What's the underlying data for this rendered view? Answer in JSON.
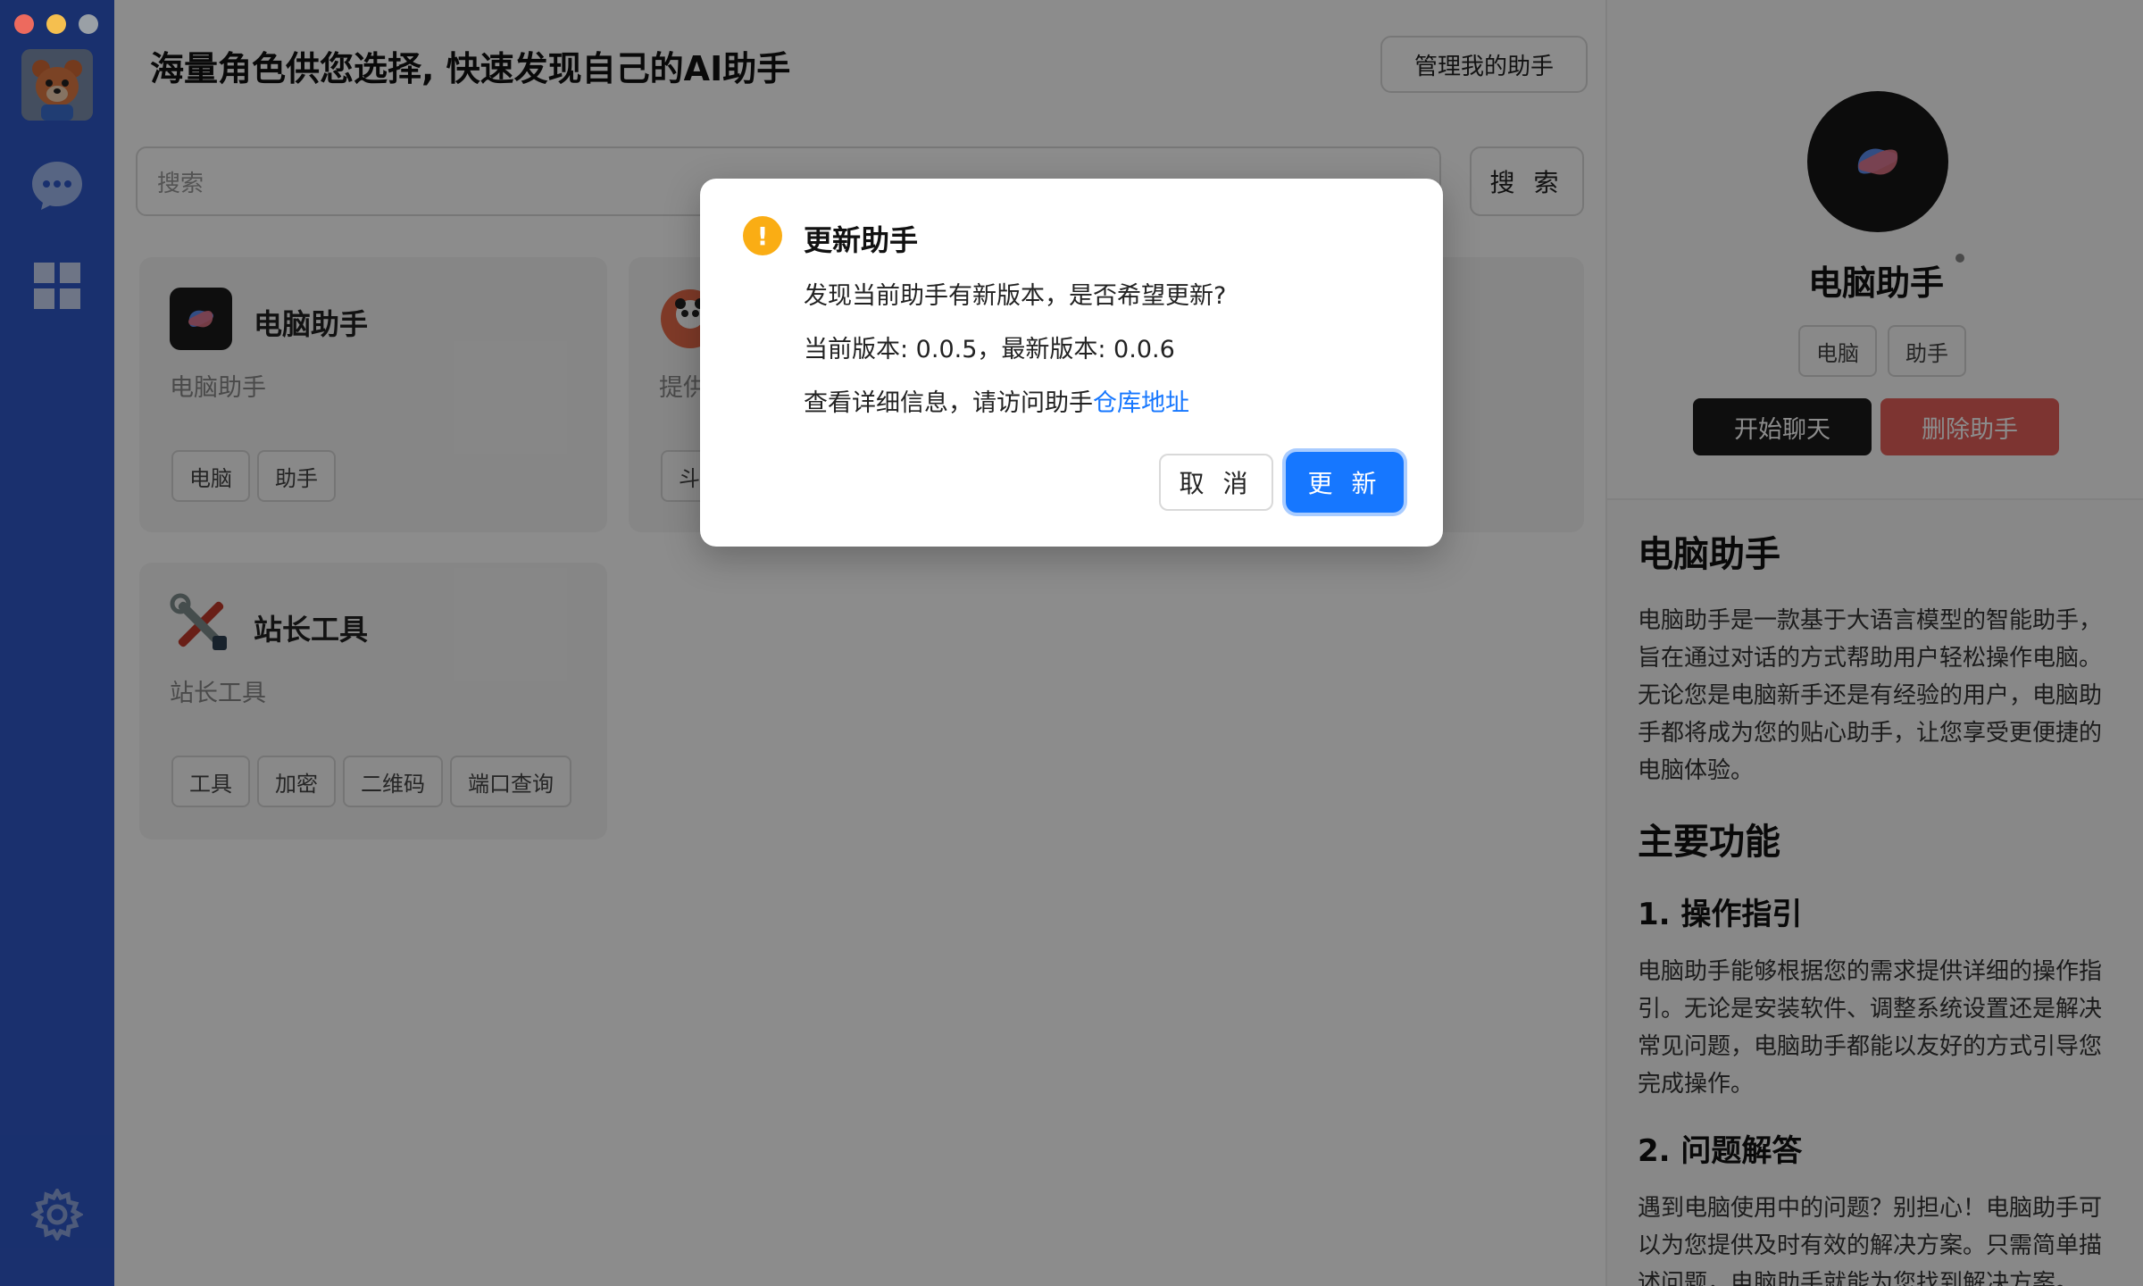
{
  "window": {
    "traffic": [
      "close",
      "minimize",
      "maximize"
    ]
  },
  "sidebar": {
    "items": [
      {
        "icon": "chat-bubble-icon"
      },
      {
        "icon": "grid-icon"
      },
      {
        "icon": "gear-icon"
      }
    ]
  },
  "main": {
    "title": "海量角色供您选择, 快速发现自己的AI助手",
    "manage_label": "管理我的助手",
    "search_placeholder": "搜索",
    "search_label": "搜 索",
    "cards": [
      {
        "name": "电脑助手",
        "desc": "电脑助手",
        "tags": [
          "电脑",
          "助手"
        ]
      },
      {
        "name": "",
        "desc": "提供",
        "tags": [
          "斗"
        ]
      },
      {
        "name": "站长工具",
        "desc": "站长工具",
        "tags": [
          "工具",
          "加密",
          "二维码",
          "端口查询"
        ]
      }
    ]
  },
  "detail": {
    "name": "电脑助手",
    "tags": [
      "电脑",
      "助手"
    ],
    "chat_label": "开始聊天",
    "delete_label": "删除助手",
    "heading": "电脑助手",
    "intro": "电脑助手是一款基于大语言模型的智能助手，旨在通过对话的方式帮助用户轻松操作电脑。无论您是电脑新手还是有经验的用户，电脑助手都将成为您的贴心助手，让您享受更便捷的电脑体验。",
    "section_title": "主要功能",
    "features": [
      {
        "title": "1. 操作指引",
        "text": "电脑助手能够根据您的需求提供详细的操作指引。无论是安装软件、调整系统设置还是解决常见问题，电脑助手都能以友好的方式引导您完成操作。"
      },
      {
        "title": "2. 问题解答",
        "text": "遇到电脑使用中的问题？别担心！电脑助手可以为您提供及时有效的解决方案。只需简单描述问题，电脑助手就能为您找到解决方案。"
      }
    ]
  },
  "dialog": {
    "title": "更新助手",
    "line1": "发现当前助手有新版本，是否希望更新?",
    "line2": "当前版本: 0.0.5，最新版本: 0.0.6",
    "line3_prefix": "查看详细信息，请访问助手",
    "line3_link": "仓库地址",
    "cancel_label": "取 消",
    "ok_label": "更 新",
    "icon": "warning-icon",
    "warn_symbol": "!"
  },
  "colors": {
    "sidebar": "#2f58c8",
    "primary": "#1677ff",
    "danger": "#e4605a",
    "warning": "#faad14"
  }
}
